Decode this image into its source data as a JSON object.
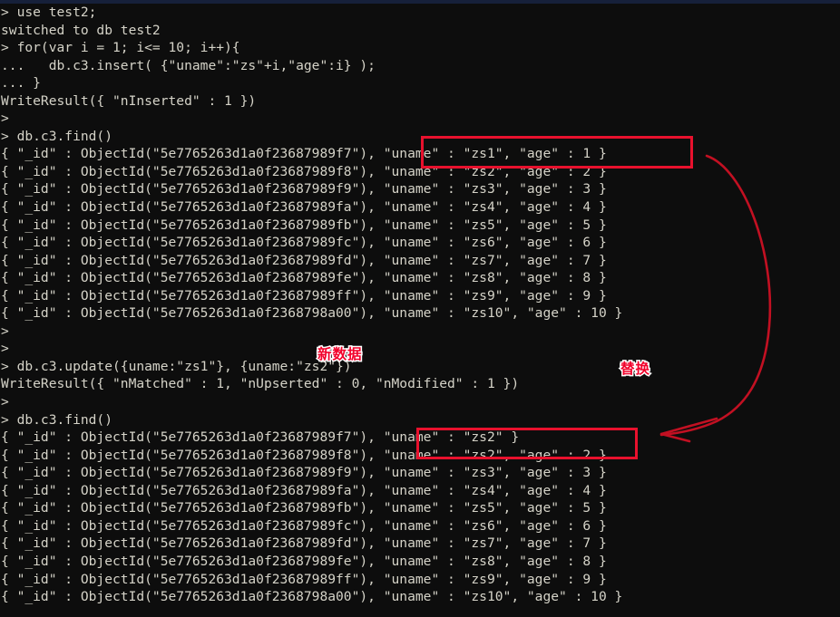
{
  "window": {
    "title": "MongoDB Shell",
    "background_color": "#0d0d0d",
    "text_color": "#d5d3c8",
    "accent_color": "#e8112d"
  },
  "terminal": {
    "prompt": ">",
    "continuation": "...",
    "lines": [
      "> use test2;",
      "switched to db test2",
      "> for(var i = 1; i<= 10; i++){",
      "...   db.c3.insert( {\"uname\":\"zs\"+i,\"age\":i} );",
      "... }",
      "WriteResult({ \"nInserted\" : 1 })",
      ">",
      "> db.c3.find()",
      "{ \"_id\" : ObjectId(\"5e7765263d1a0f23687989f7\"), \"uname\" : \"zs1\", \"age\" : 1 }",
      "{ \"_id\" : ObjectId(\"5e7765263d1a0f23687989f8\"), \"uname\" : \"zs2\", \"age\" : 2 }",
      "{ \"_id\" : ObjectId(\"5e7765263d1a0f23687989f9\"), \"uname\" : \"zs3\", \"age\" : 3 }",
      "{ \"_id\" : ObjectId(\"5e7765263d1a0f23687989fa\"), \"uname\" : \"zs4\", \"age\" : 4 }",
      "{ \"_id\" : ObjectId(\"5e7765263d1a0f23687989fb\"), \"uname\" : \"zs5\", \"age\" : 5 }",
      "{ \"_id\" : ObjectId(\"5e7765263d1a0f23687989fc\"), \"uname\" : \"zs6\", \"age\" : 6 }",
      "{ \"_id\" : ObjectId(\"5e7765263d1a0f23687989fd\"), \"uname\" : \"zs7\", \"age\" : 7 }",
      "{ \"_id\" : ObjectId(\"5e7765263d1a0f23687989fe\"), \"uname\" : \"zs8\", \"age\" : 8 }",
      "{ \"_id\" : ObjectId(\"5e7765263d1a0f23687989ff\"), \"uname\" : \"zs9\", \"age\" : 9 }",
      "{ \"_id\" : ObjectId(\"5e7765263d1a0f2368798a00\"), \"uname\" : \"zs10\", \"age\" : 10 }",
      ">",
      ">",
      "> db.c3.update({uname:\"zs1\"}, {uname:\"zs2\"})",
      "WriteResult({ \"nMatched\" : 1, \"nUpserted\" : 0, \"nModified\" : 1 })",
      ">",
      "> db.c3.find()",
      "{ \"_id\" : ObjectId(\"5e7765263d1a0f23687989f7\"), \"uname\" : \"zs2\" }",
      "{ \"_id\" : ObjectId(\"5e7765263d1a0f23687989f8\"), \"uname\" : \"zs2\", \"age\" : 2 }",
      "{ \"_id\" : ObjectId(\"5e7765263d1a0f23687989f9\"), \"uname\" : \"zs3\", \"age\" : 3 }",
      "{ \"_id\" : ObjectId(\"5e7765263d1a0f23687989fa\"), \"uname\" : \"zs4\", \"age\" : 4 }",
      "{ \"_id\" : ObjectId(\"5e7765263d1a0f23687989fb\"), \"uname\" : \"zs5\", \"age\" : 5 }",
      "{ \"_id\" : ObjectId(\"5e7765263d1a0f23687989fc\"), \"uname\" : \"zs6\", \"age\" : 6 }",
      "{ \"_id\" : ObjectId(\"5e7765263d1a0f23687989fd\"), \"uname\" : \"zs7\", \"age\" : 7 }",
      "{ \"_id\" : ObjectId(\"5e7765263d1a0f23687989fe\"), \"uname\" : \"zs8\", \"age\" : 8 }",
      "{ \"_id\" : ObjectId(\"5e7765263d1a0f23687989ff\"), \"uname\" : \"zs9\", \"age\" : 9 }",
      "{ \"_id\" : ObjectId(\"5e7765263d1a0f2368798a00\"), \"uname\" : \"zs10\", \"age\" : 10 }"
    ]
  },
  "annotations": {
    "color": "#e8112d",
    "label_new_data": "新数据",
    "label_replace": "替换",
    "box_1_target": "{ \"_id\" : ObjectId(\"5e7765263d1a0f23687989f7\"), \"uname\" : \"zs1\", \"age\" : 1 }",
    "box_2_target": "{ \"_id\" : ObjectId(\"5e7765263d1a0f23687989f7\"), \"uname\" : \"zs2\" }"
  }
}
